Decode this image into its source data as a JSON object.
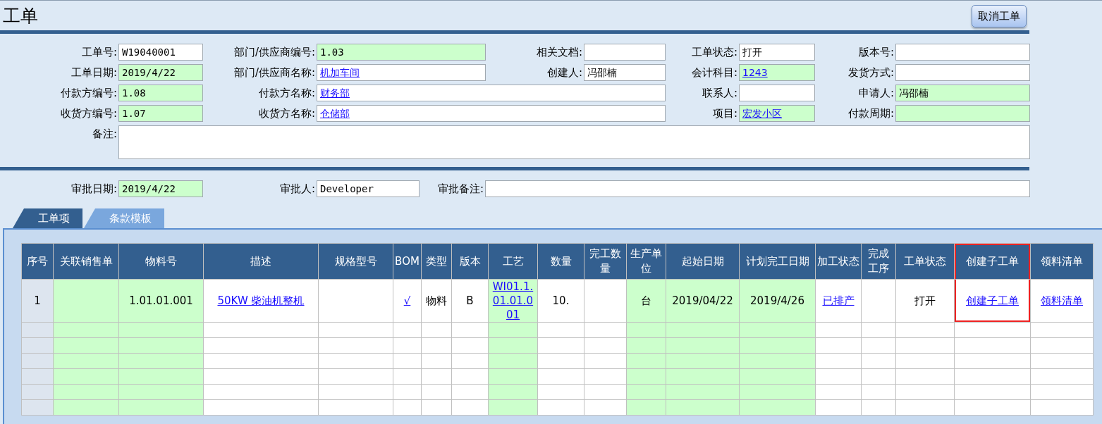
{
  "title": "工单",
  "cancel_button": "取消工单",
  "form_rows": [
    [
      {
        "label": "工单号:",
        "value": "W19040001",
        "kind": "input",
        "highlighted": false,
        "link": false
      },
      {
        "label": "部门/供应商编号:",
        "value": "1.03",
        "kind": "input",
        "highlighted": true,
        "link": false
      },
      {
        "label": "相关文档:",
        "kind": "input",
        "highlighted": false
      },
      {
        "label": "工单状态:",
        "value": "打开",
        "kind": "input",
        "highlighted": false,
        "link": false
      },
      {
        "label": "版本号:",
        "kind": "input",
        "highlighted": false
      }
    ],
    [
      {
        "label": "工单日期:",
        "value": "2019/4/22",
        "kind": "input",
        "highlighted": true,
        "link": false
      },
      {
        "label": "部门/供应商名称:",
        "value": "机加车间",
        "kind": "input",
        "highlighted": false,
        "link": true
      },
      {
        "label": "创建人:",
        "value": "冯邵楠",
        "kind": "input",
        "highlighted": false,
        "link": false
      },
      {
        "label": "会计科目:",
        "value": "1243",
        "kind": "input",
        "highlighted": true,
        "link": true
      },
      {
        "label": "发货方式:",
        "kind": "input",
        "highlighted": false
      }
    ],
    [
      {
        "label": "付款方编号:",
        "value": "1.08",
        "kind": "input",
        "highlighted": true,
        "link": false
      },
      {
        "label": "付款方名称:",
        "value": "财务部",
        "kind": "wide",
        "highlighted": false,
        "link": true
      },
      {
        "label": "联系人:",
        "kind": "input",
        "highlighted": false
      },
      {
        "label": "申请人:",
        "value": "冯邵楠",
        "kind": "input",
        "highlighted": true,
        "link": false
      }
    ],
    [
      {
        "label": "收货方编号:",
        "value": "1.07",
        "kind": "input",
        "highlighted": true,
        "link": false
      },
      {
        "label": "收货方名称:",
        "value": "仓储部",
        "kind": "wide",
        "highlighted": false,
        "link": true
      },
      {
        "label": "项目:",
        "value": "宏发小区",
        "kind": "input",
        "highlighted": true,
        "link": true
      },
      {
        "label": "付款周期:",
        "kind": "input",
        "highlighted": true
      }
    ],
    [
      {
        "label": "备注:",
        "kind": "memo",
        "highlighted": false
      }
    ]
  ],
  "approval": [
    {
      "label": "审批日期:",
      "value": "2019/4/22",
      "highlighted": true
    },
    {
      "label": "审批人:",
      "value": "Developer",
      "highlighted": false
    },
    {
      "label": "审批备注:",
      "highlighted": false
    }
  ],
  "tabs": [
    {
      "label": "工单项",
      "selected": true
    },
    {
      "label": "条款模板",
      "selected": false
    }
  ],
  "table": {
    "columns": [
      {
        "title": "序号",
        "highlighted": false,
        "annotated": false
      },
      {
        "title": "关联销售单",
        "highlighted": true,
        "annotated": false
      },
      {
        "title": "物料号",
        "highlighted": true,
        "annotated": false
      },
      {
        "title": "描述",
        "highlighted": false,
        "annotated": false
      },
      {
        "title": "规格型号",
        "highlighted": false,
        "annotated": false
      },
      {
        "title": "BOM",
        "highlighted": false,
        "annotated": false
      },
      {
        "title": "类型",
        "highlighted": false,
        "annotated": false
      },
      {
        "title": "版本",
        "highlighted": false,
        "annotated": false
      },
      {
        "title": "工艺",
        "highlighted": true,
        "annotated": false
      },
      {
        "title": "数量",
        "highlighted": false,
        "annotated": false
      },
      {
        "title": "完工数量",
        "highlighted": false,
        "annotated": false
      },
      {
        "title": "生产单位",
        "highlighted": true,
        "annotated": false
      },
      {
        "title": "起始日期",
        "highlighted": true,
        "annotated": false
      },
      {
        "title": "计划完工日期",
        "highlighted": true,
        "annotated": false
      },
      {
        "title": "加工状态",
        "highlighted": false,
        "annotated": false
      },
      {
        "title": "完成工序",
        "highlighted": false,
        "annotated": false
      },
      {
        "title": "工单状态",
        "highlighted": false,
        "annotated": false
      },
      {
        "title": "创建子工单",
        "highlighted": false,
        "annotated": true
      },
      {
        "title": "领料清单",
        "highlighted": false,
        "annotated": false
      }
    ],
    "rows": [
      {
        "cells": [
          {
            "text": "1",
            "kind": "text"
          },
          null,
          {
            "text": "1.01.01.001",
            "kind": "text"
          },
          {
            "text": "50KW 柴油机整机",
            "kind": "link"
          },
          null,
          {
            "text": "√",
            "kind": "link"
          },
          {
            "text": "物料",
            "kind": "text"
          },
          {
            "text": "B",
            "kind": "text"
          },
          {
            "text": "WI01.1.01.01.001",
            "kind": "link"
          },
          {
            "text": "10.",
            "kind": "text"
          },
          null,
          {
            "text": "台",
            "kind": "text"
          },
          {
            "text": "2019/04/22",
            "kind": "text"
          },
          {
            "text": "2019/4/26",
            "kind": "text"
          },
          {
            "text": "已排产",
            "kind": "link"
          },
          null,
          {
            "text": "打开",
            "kind": "text"
          },
          {
            "text": "创建子工单",
            "kind": "link"
          },
          {
            "text": "领料清单",
            "kind": "link"
          }
        ]
      }
    ]
  }
}
